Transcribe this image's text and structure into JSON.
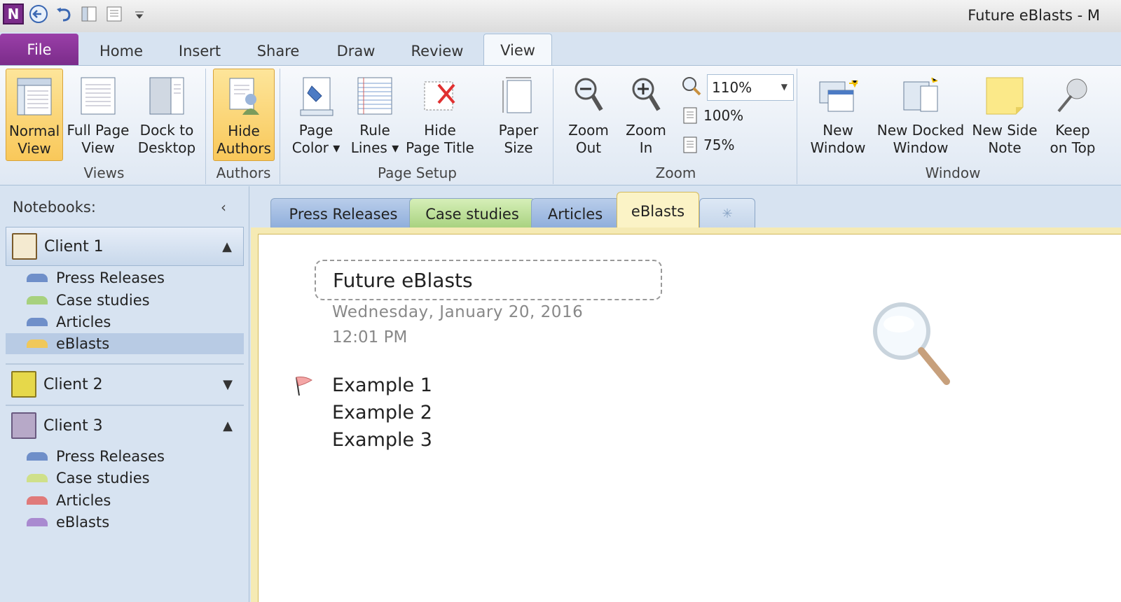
{
  "window": {
    "title": "Future eBlasts  -  M"
  },
  "qat": {
    "app_letter": "N"
  },
  "tabs": [
    "Home",
    "Insert",
    "Share",
    "Draw",
    "Review",
    "View"
  ],
  "file_tab": "File",
  "ribbon": {
    "views": {
      "label": "Views",
      "normal": [
        "Normal",
        "View"
      ],
      "fullpage": [
        "Full Page",
        "View"
      ],
      "dock": [
        "Dock to",
        "Desktop"
      ]
    },
    "authors": {
      "label": "Authors",
      "hide": [
        "Hide",
        "Authors"
      ]
    },
    "page_setup": {
      "label": "Page Setup",
      "page_color": [
        "Page",
        "Color"
      ],
      "rule_lines": [
        "Rule",
        "Lines"
      ],
      "hide_title": [
        "Hide",
        "Page Title"
      ],
      "paper_size": [
        "Paper",
        "Size"
      ]
    },
    "zoom": {
      "label": "Zoom",
      "out": [
        "Zoom",
        "Out"
      ],
      "in": [
        "Zoom",
        "In"
      ],
      "value": "110%",
      "p100": "100%",
      "p75": "75%"
    },
    "window": {
      "label": "Window",
      "new_window": [
        "New",
        "Window"
      ],
      "new_docked": [
        "New Docked",
        "Window"
      ],
      "side_note": [
        "New Side",
        "Note"
      ],
      "keep_top": [
        "Keep",
        "on Top"
      ]
    }
  },
  "nav": {
    "header": "Notebooks:",
    "notebooks": [
      {
        "name": "Client 1",
        "sections": [
          "Press Releases",
          "Case studies",
          "Articles",
          "eBlasts"
        ]
      },
      {
        "name": "Client 2",
        "sections": []
      },
      {
        "name": "Client 3",
        "sections": [
          "Press Releases",
          "Case studies",
          "Articles",
          "eBlasts"
        ]
      }
    ]
  },
  "section_tabs": [
    "Press Releases",
    "Case studies",
    "Articles",
    "eBlasts"
  ],
  "page": {
    "title": "Future  eBlasts",
    "date": "Wednesday, January 20, 2016",
    "time": "12:01 PM",
    "items": [
      "Example 1",
      "Example 2",
      "Example 3"
    ]
  },
  "colors": {
    "file_tab": "#7b2c8a",
    "selected_button": "#f9c85a",
    "section_blue": "#6f8fc9",
    "section_green": "#a7d17e",
    "section_yellow": "#f0c85a",
    "section_red": "#e07a7a",
    "section_purple": "#a98ad0"
  }
}
